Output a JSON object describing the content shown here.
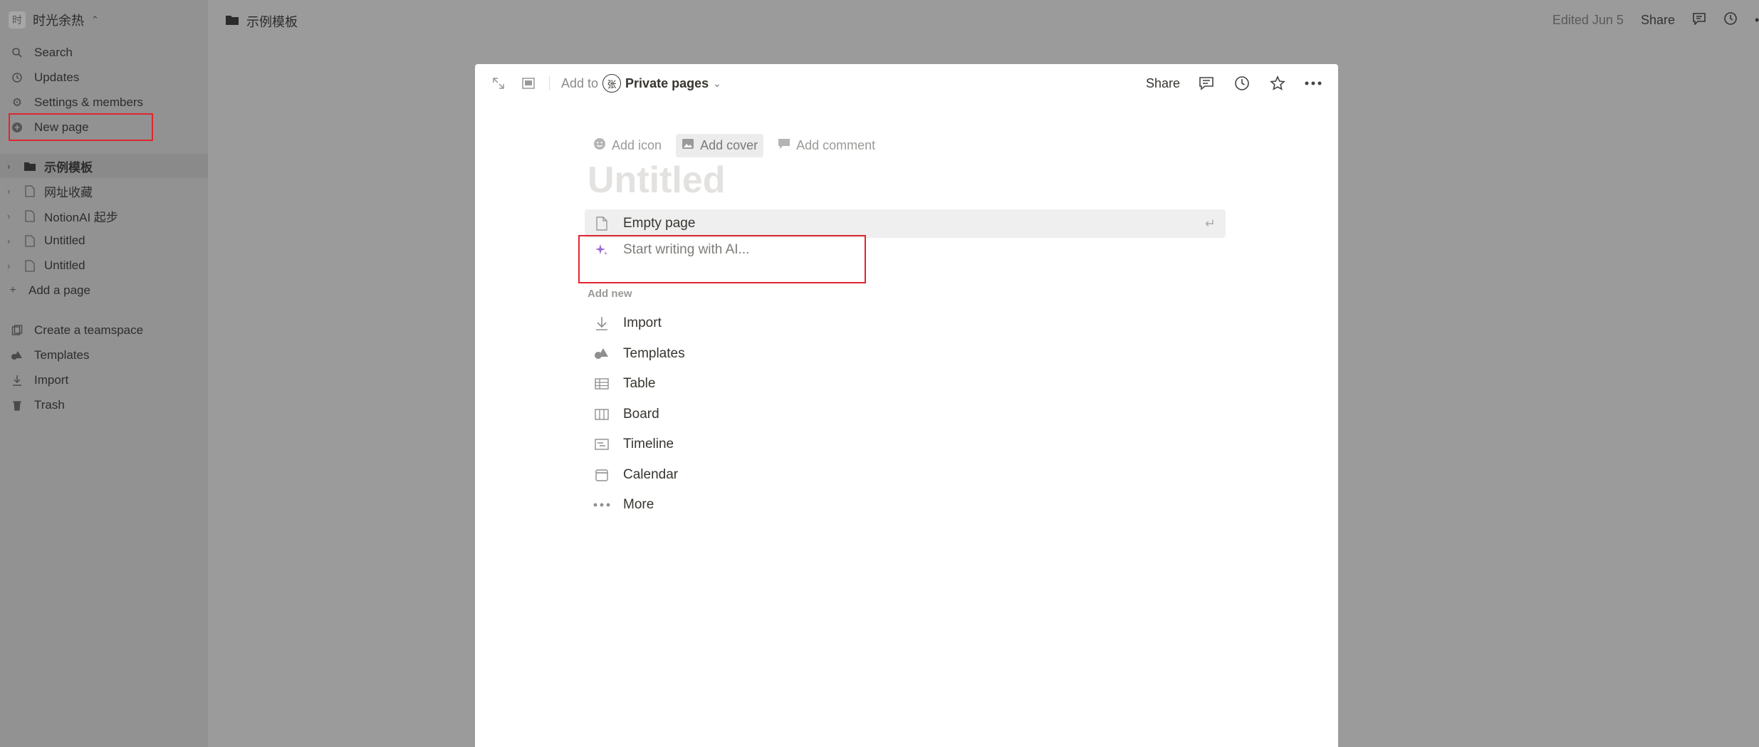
{
  "sidebar": {
    "workspace_avatar": "时",
    "workspace_name": "时光余热",
    "nav": [
      {
        "label": "Search",
        "icon": "search-icon"
      },
      {
        "label": "Updates",
        "icon": "clock-icon"
      },
      {
        "label": "Settings & members",
        "icon": "gear-icon"
      },
      {
        "label": "New page",
        "icon": "plus-circle-icon"
      }
    ],
    "pages": [
      {
        "label": "示例模板",
        "icon": "folder-icon",
        "active": true
      },
      {
        "label": "网址收藏",
        "icon": "page-icon"
      },
      {
        "label": "NotionAI 起步",
        "icon": "page-icon"
      },
      {
        "label": "Untitled",
        "icon": "page-icon"
      },
      {
        "label": "Untitled",
        "icon": "page-icon"
      }
    ],
    "add_page": "Add a page",
    "bottom": [
      {
        "label": "Create a teamspace",
        "icon": "teamspace-icon"
      },
      {
        "label": "Templates",
        "icon": "templates-icon"
      },
      {
        "label": "Import",
        "icon": "import-icon"
      },
      {
        "label": "Trash",
        "icon": "trash-icon"
      }
    ]
  },
  "topbar": {
    "breadcrumb": "示例模板",
    "edited": "Edited Jun 5",
    "share": "Share"
  },
  "modal": {
    "add_to": "Add to",
    "badge": "张",
    "location": "Private pages",
    "share": "Share",
    "add_icon": "Add icon",
    "add_cover": "Add cover",
    "add_comment": "Add comment",
    "title_placeholder": "Untitled",
    "empty_page": "Empty page",
    "ai_placeholder": "Start writing with AI...",
    "add_new_label": "Add new",
    "options": [
      {
        "label": "Import",
        "icon": "import-icon"
      },
      {
        "label": "Templates",
        "icon": "templates-icon"
      },
      {
        "label": "Table",
        "icon": "table-icon"
      },
      {
        "label": "Board",
        "icon": "board-icon"
      },
      {
        "label": "Timeline",
        "icon": "timeline-icon"
      },
      {
        "label": "Calendar",
        "icon": "calendar-icon"
      },
      {
        "label": "More",
        "icon": "more-icon"
      }
    ]
  },
  "colors": {
    "highlight_border": "#e0262e",
    "ai_accent": "#9b6bd6"
  }
}
